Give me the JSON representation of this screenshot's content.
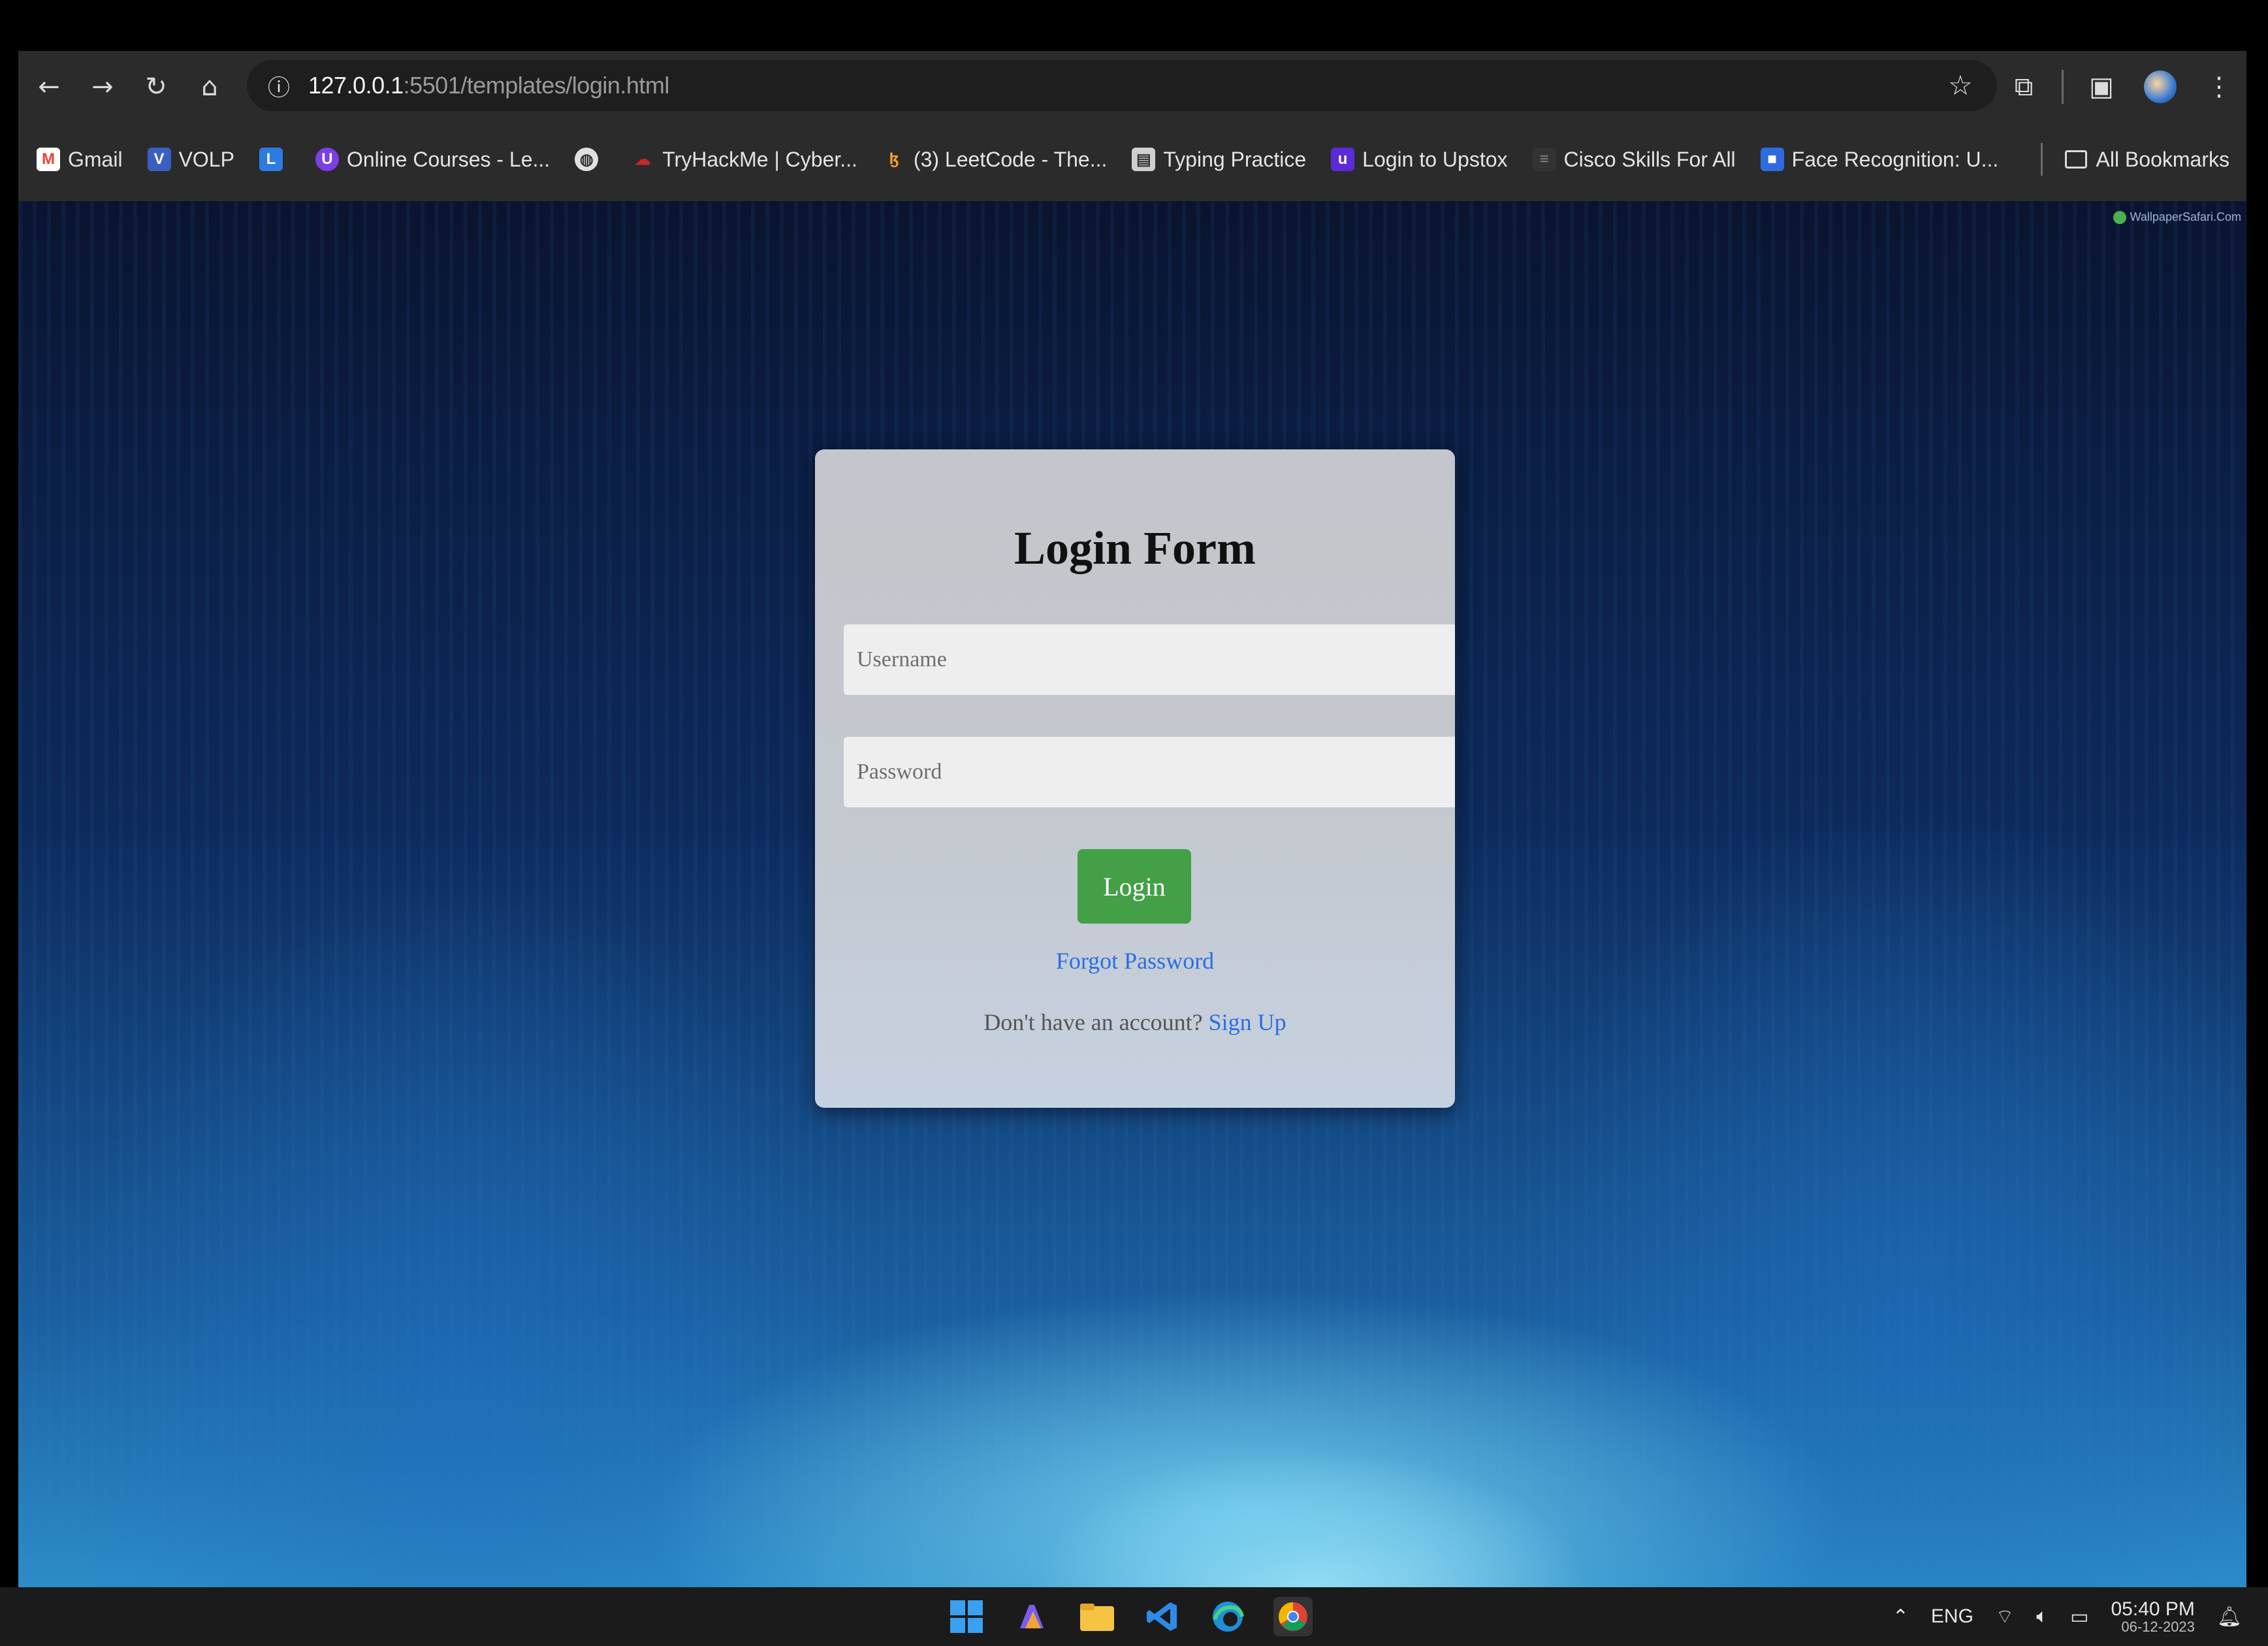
{
  "browser": {
    "url_host": "127.0.0.1",
    "url_path": ":5501/templates/login.html",
    "bookmarks": [
      {
        "label": "Gmail",
        "icon": "gmail-icon",
        "color": "#ea4335"
      },
      {
        "label": "VOLP",
        "icon": "volp-icon",
        "color": "#3b5fc0"
      },
      {
        "label": "",
        "icon": "bookmark-app-icon",
        "color": "#2d7be0"
      },
      {
        "label": "Online Courses - Le...",
        "icon": "online-courses-icon",
        "color": "#7b3fe4"
      },
      {
        "label": "",
        "icon": "globe-icon",
        "color": "#9e9e9e"
      },
      {
        "label": "TryHackMe | Cyber...",
        "icon": "tryhackme-icon",
        "color": "#c62828"
      },
      {
        "label": "(3) LeetCode - The...",
        "icon": "leetcode-icon",
        "color": "#f5a623"
      },
      {
        "label": "Typing Practice",
        "icon": "typing-icon",
        "color": "#9e9e9e"
      },
      {
        "label": "Login to Upstox",
        "icon": "upstox-icon",
        "color": "#5a2bd6"
      },
      {
        "label": "Cisco Skills For All",
        "icon": "cisco-icon",
        "color": "#333333"
      },
      {
        "label": "Face Recognition: U...",
        "icon": "face-recognition-icon",
        "color": "#2d6cdf"
      }
    ],
    "all_bookmarks": "All Bookmarks"
  },
  "page": {
    "watermark": "WallpaperSafari.Com",
    "form": {
      "title": "Login Form",
      "username_placeholder": "Username",
      "password_placeholder": "Password",
      "login_label": "Login",
      "forgot_label": "Forgot Password",
      "signup_prompt": "Don't have an account? ",
      "signup_label": "Sign Up"
    }
  },
  "taskbar": {
    "language": "ENG",
    "time": "05:40 PM",
    "date": "06-12-2023"
  },
  "colors": {
    "login_button": "#43a047",
    "link": "#2a6fe0",
    "browser_chrome": "#2b2b2b"
  }
}
